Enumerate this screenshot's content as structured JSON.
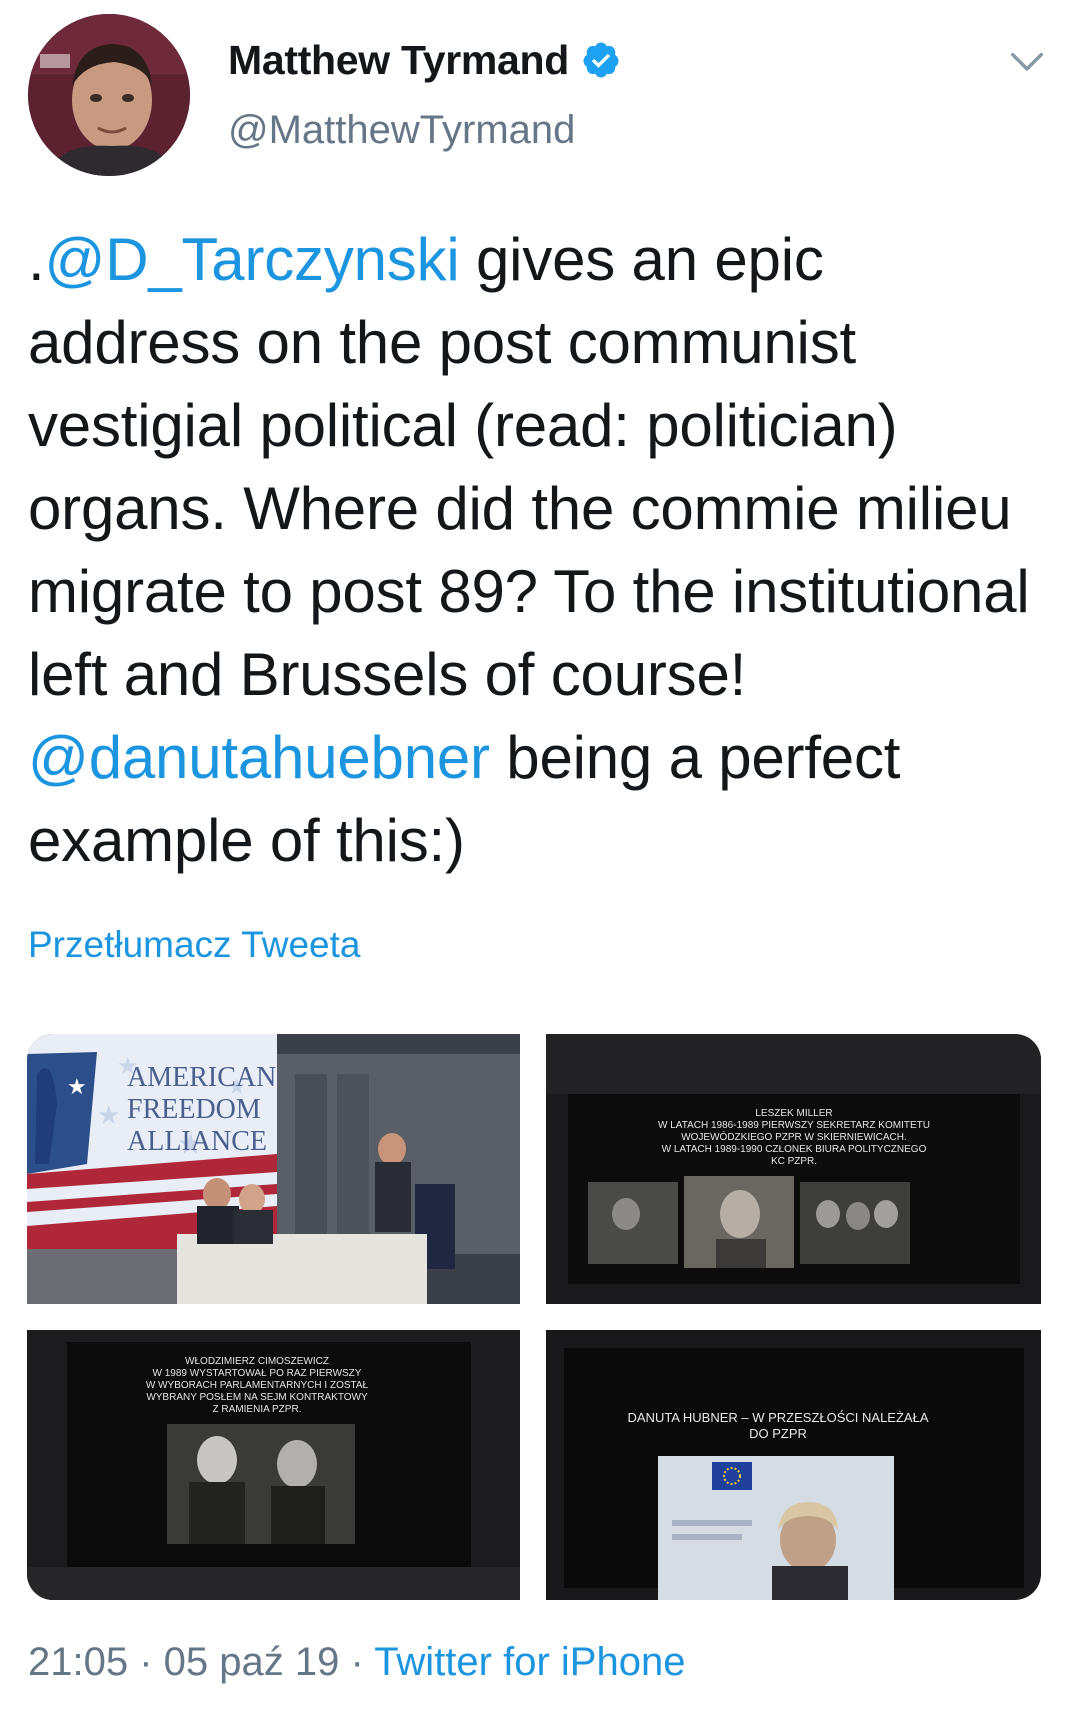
{
  "author": {
    "display_name": "Matthew Tyrmand",
    "handle": "@MatthewTyrmand",
    "verified_icon": "verified-badge-icon",
    "accent_color": "#1da1f2"
  },
  "tweet": {
    "text_parts": [
      {
        "text": ".",
        "type": "text"
      },
      {
        "text": "@D_Tarczynski",
        "type": "mention"
      },
      {
        "text": " gives an epic address on the post communist vestigial political (read: politician) organs. Where did the commie milieu migrate to post 89? To the institutional left and Brussels of course! ",
        "type": "text"
      },
      {
        "text": "@danutahuebner",
        "type": "mention"
      },
      {
        "text": " being a perfect example of this:)",
        "type": "text"
      }
    ],
    "translate_label": "Przetłumacz Tweeta"
  },
  "media": {
    "photo1": {
      "banner_lines": [
        "AMERICAN",
        "FREEDOM",
        "ALLIANCE"
      ]
    },
    "photo2": {
      "slide_lines": [
        "LESZEK MILLER",
        "W LATACH 1986-1989 PIERWSZY SEKRETARZ KOMITETU",
        "WOJEWÓDZKIEGO PZPR W SKIERNIEWICACH.",
        "W LATACH 1989-1990 CZŁONEK BIURA POLITYCZNEGO",
        "KC PZPR."
      ]
    },
    "photo3": {
      "slide_lines": [
        "WŁODZIMIERZ CIMOSZEWICZ",
        "W 1989 WYSTARTOWAŁ PO RAZ PIERWSZY",
        "W WYBORACH PARLAMENTARNYCH I ZOSTAŁ",
        "WYBRANY POSŁEM NA SEJM KONTRAKTOWY",
        "Z RAMIENIA PZPR."
      ]
    },
    "photo4": {
      "slide_lines": [
        "DANUTA HUBNER – W PRZESZŁOŚCI NALEŻAŁA",
        "DO PZPR"
      ]
    }
  },
  "meta": {
    "time": "21:05",
    "separator": " · ",
    "date": "05 paź 19",
    "source": "Twitter for iPhone"
  },
  "colors": {
    "link": "#1b95e0",
    "secondary_text": "#657786",
    "primary_text": "#14171a"
  }
}
